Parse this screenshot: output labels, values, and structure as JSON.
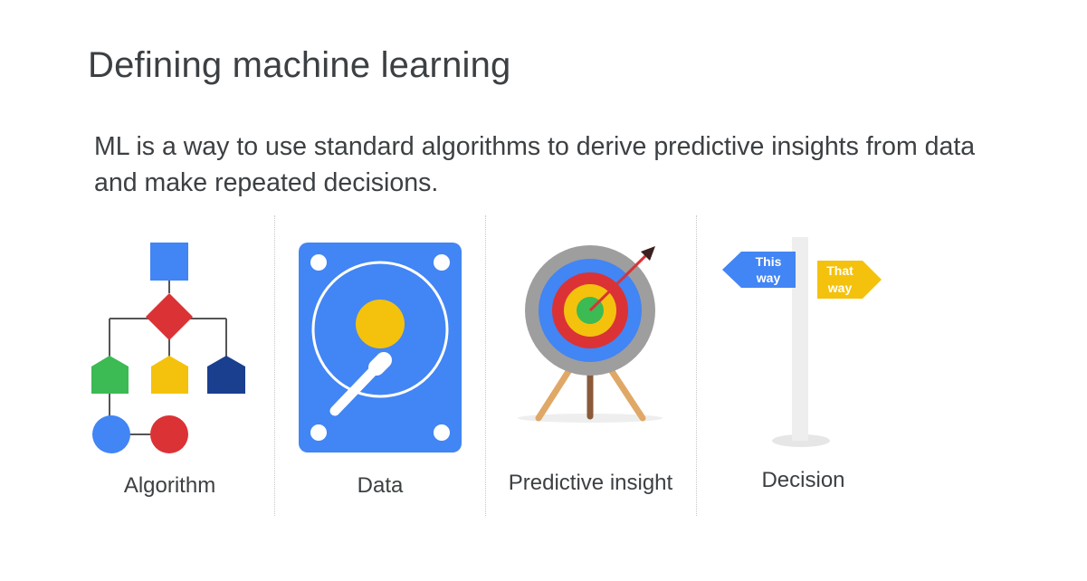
{
  "slide": {
    "title": "Defining machine learning",
    "body": "ML is a way to use standard algorithms to derive predictive insights from data and make repeated decisions."
  },
  "panels": [
    {
      "caption": "Algorithm",
      "icon": "flowchart-icon"
    },
    {
      "caption": "Data",
      "icon": "hard-drive-icon"
    },
    {
      "caption": "Predictive insight",
      "icon": "target-icon"
    },
    {
      "caption": "Decision",
      "icon": "signpost-icon"
    }
  ],
  "signpost": {
    "left_sign_line1": "This",
    "left_sign_line2": "way",
    "right_sign_line1": "That",
    "right_sign_line2": "way"
  },
  "colors": {
    "blue": "#4285f4",
    "red": "#db3236",
    "yellow": "#f4c20d",
    "green": "#3cba54",
    "navy": "#1a3f8f",
    "text": "#3c4043"
  }
}
